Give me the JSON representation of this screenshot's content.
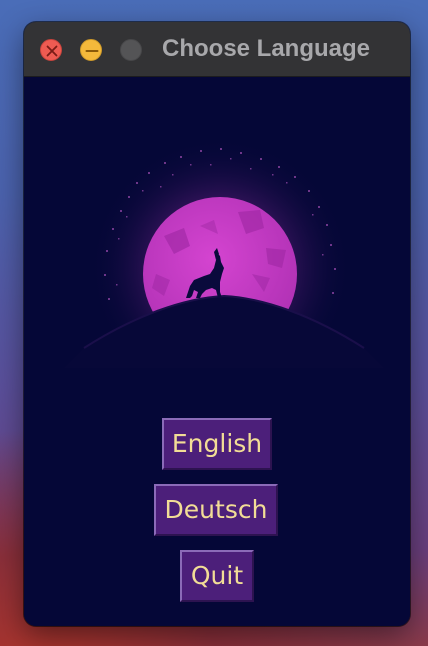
{
  "window": {
    "title": "Choose Language"
  },
  "icons": {
    "close": "close-icon",
    "minimize": "minimize-icon",
    "maximize": "maximize-icon",
    "artwork": "wolf-moon-illustration"
  },
  "colors": {
    "window_background": "#050737",
    "moon": "#c53bc5",
    "button_background": "#4c1f7a",
    "button_text": "#f2dd96"
  },
  "menu": {
    "buttons": [
      {
        "label": "English"
      },
      {
        "label": "Deutsch"
      },
      {
        "label": "Quit"
      }
    ]
  }
}
